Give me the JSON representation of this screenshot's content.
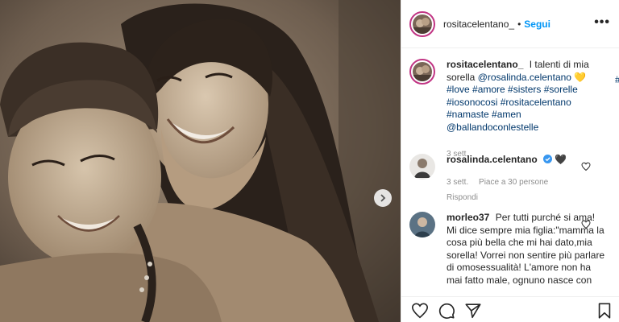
{
  "post": {
    "author": "rositacelentano_",
    "separator": "•",
    "follow_label": "Segui",
    "more_label": "•••"
  },
  "caption": {
    "username": "rositacelentano_",
    "text_1": "I talenti di mia sorella",
    "mention": "@rosalinda.celentano",
    "heart_emoji": "💛",
    "tags": "#love #amore #sisters #sorelle #iosonocosi #rositacelentano #namaste #amen @ballandoconlestelle",
    "date": "3 sett."
  },
  "comments": [
    {
      "username": "rosalinda.celentano",
      "text": "🖤",
      "date": "3 sett.",
      "likes": "Piace a 30 persone",
      "reply": "Rispondi"
    },
    {
      "username": "morleo37",
      "text": "Per tutti purché si ama! Mi dice sempre mia figlia:\"mamma la cosa più bella che mi hai dato,mia sorella! Vorrei non sentire più parlare di omosessualità! L'amore non ha mai fatto male, ognuno nasce con"
    }
  ],
  "icons": {
    "next": "chevron-right-icon",
    "like": "heart-icon",
    "comment": "comment-icon",
    "share": "paper-plane-icon",
    "save": "bookmark-icon"
  },
  "colors": {
    "link": "#00376b",
    "follow": "#0095f6",
    "verified": "#3897f0"
  },
  "cut_right": "#"
}
